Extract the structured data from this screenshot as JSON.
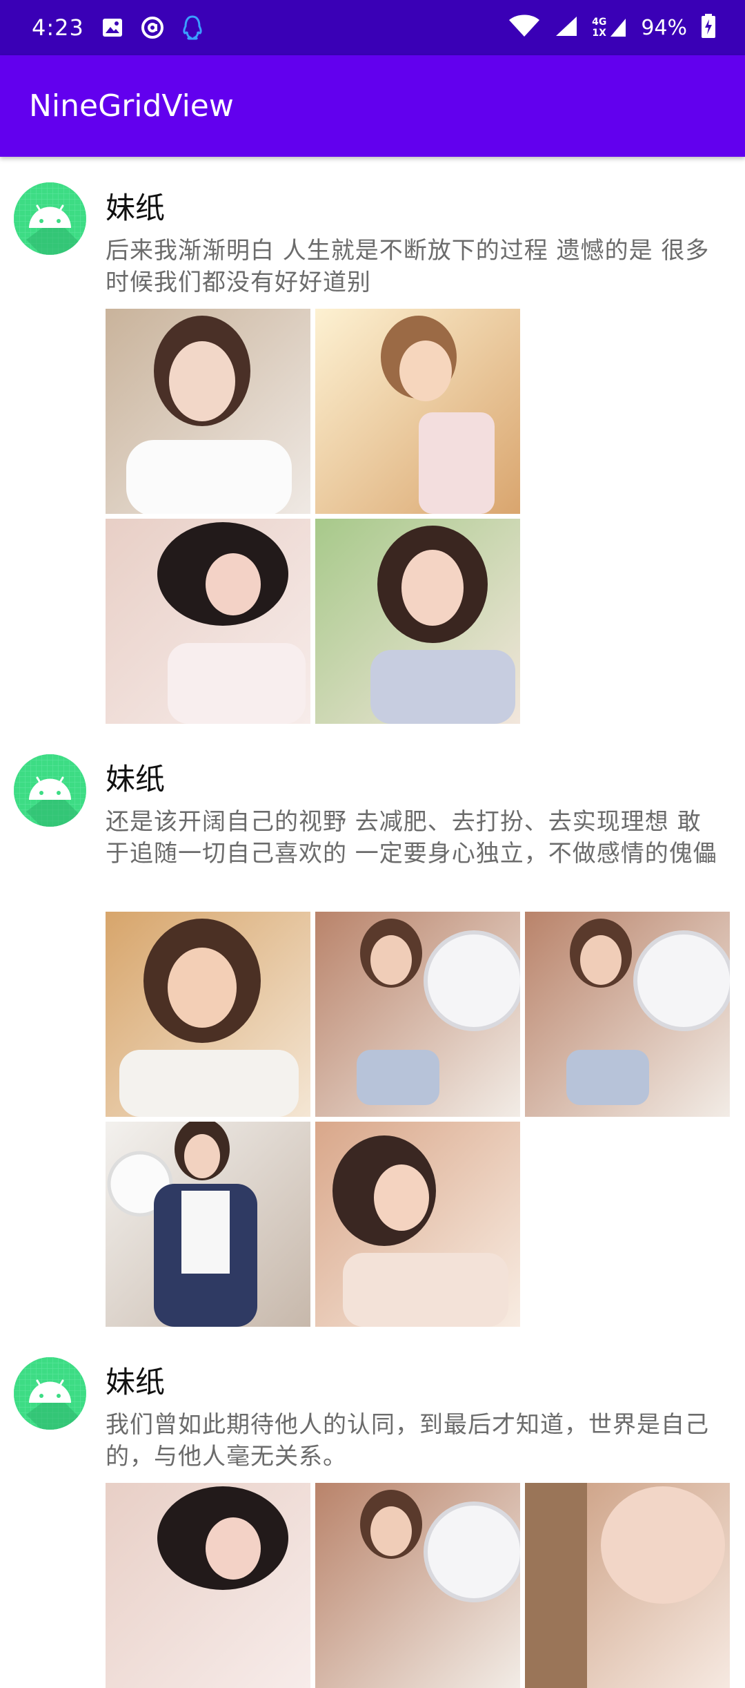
{
  "status_bar": {
    "time": "4:23",
    "battery": "94%",
    "network_top": "4G",
    "network_bottom": "1X",
    "icons": [
      "image-icon",
      "at-sign-icon",
      "qq-icon",
      "wifi-icon",
      "signal-icon",
      "battery-charging-icon"
    ]
  },
  "app_bar": {
    "title": "NineGridView"
  },
  "posts": [
    {
      "author": "妹纸",
      "text": "后来我渐渐明白 人生就是不断放下的过程 遗憾的是 很多时候我们都没有好好道别",
      "images": [
        "photo-1",
        "photo-2",
        "photo-3",
        "photo-4"
      ]
    },
    {
      "author": "妹纸",
      "text": "还是该开阔自己的视野 去减肥、去打扮、去实现理想 敢于追随一切自己喜欢的 一定要身心独立，不做感情的傀儡",
      "images": [
        "photo-5",
        "photo-6",
        "photo-7",
        "photo-8",
        "photo-9"
      ]
    },
    {
      "author": "妹纸",
      "text": "我们曾如此期待他人的认同，到最后才知道，世界是自己的，与他人毫无关系。",
      "images": [
        "photo-10",
        "photo-11",
        "photo-12"
      ]
    }
  ],
  "colors": {
    "status_bar": "#3a00b6",
    "app_bar": "#6200ee",
    "avatar": "#3ddc84",
    "body_text": "#6b6b6b"
  }
}
